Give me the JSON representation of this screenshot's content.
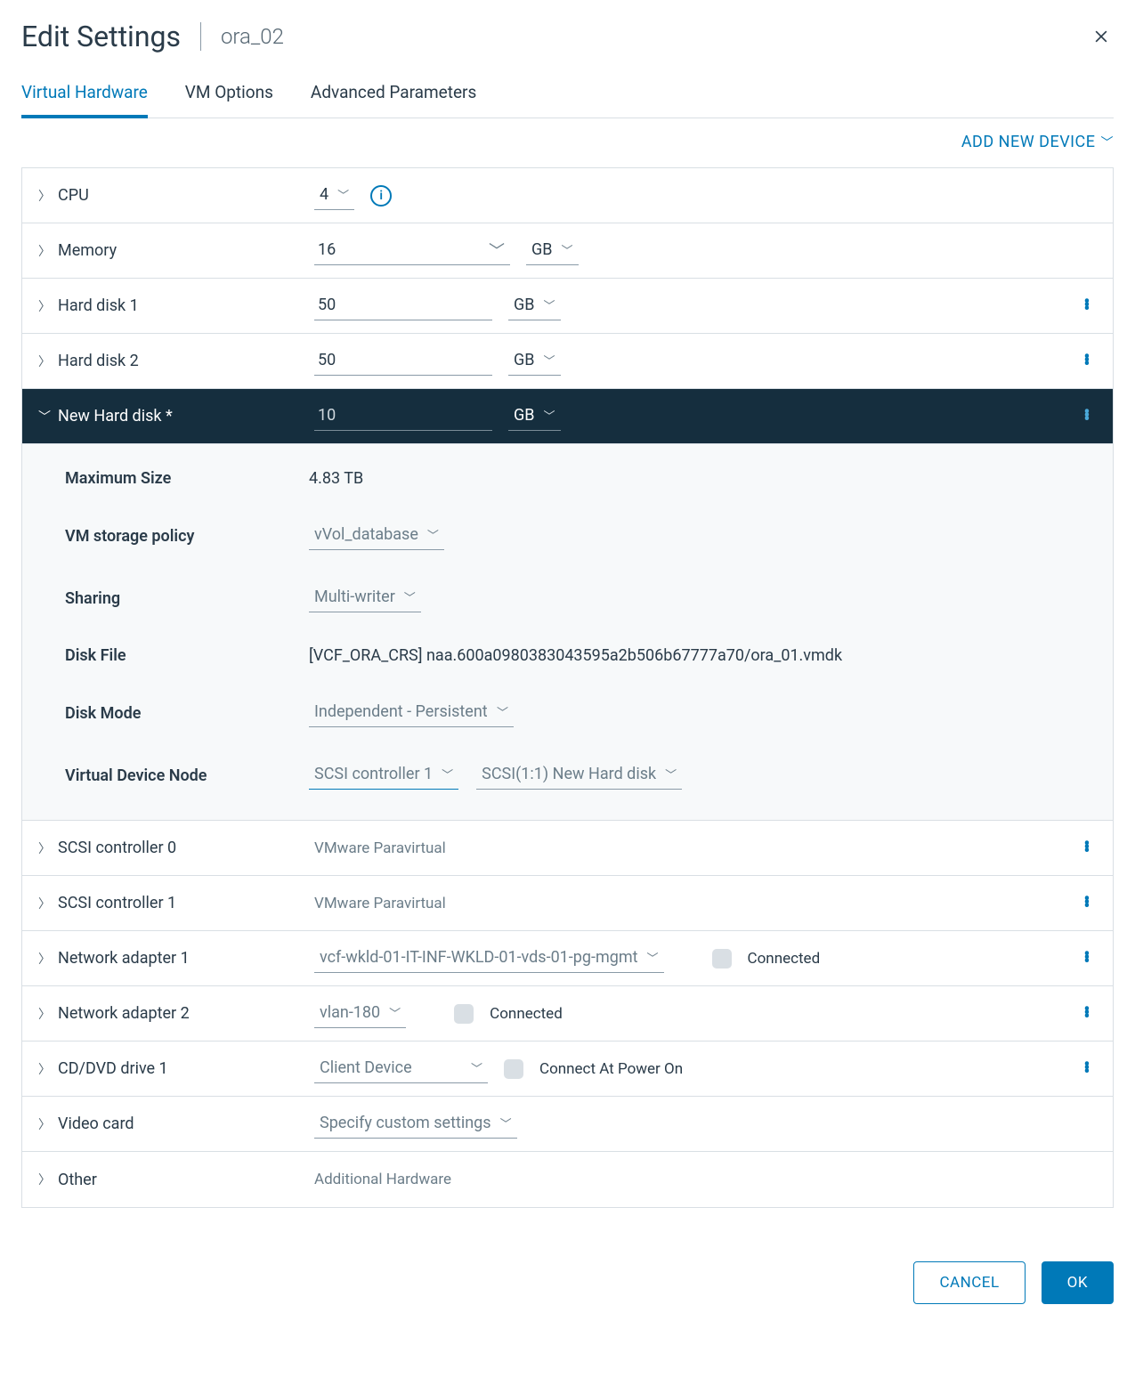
{
  "header": {
    "title": "Edit Settings",
    "vm_name": "ora_02"
  },
  "tabs": {
    "t0": "Virtual Hardware",
    "t1": "VM Options",
    "t2": "Advanced Parameters",
    "active": 0
  },
  "add_device": "ADD NEW DEVICE",
  "rows": {
    "cpu": {
      "label": "CPU",
      "value": "4"
    },
    "memory": {
      "label": "Memory",
      "value": "16",
      "unit": "GB"
    },
    "hd1": {
      "label": "Hard disk 1",
      "value": "50",
      "unit": "GB"
    },
    "hd2": {
      "label": "Hard disk 2",
      "value": "50",
      "unit": "GB"
    },
    "newhd": {
      "label": "New Hard disk *",
      "value": "10",
      "unit": "GB"
    },
    "scsi0": {
      "label": "SCSI controller 0",
      "value": "VMware Paravirtual"
    },
    "scsi1": {
      "label": "SCSI controller 1",
      "value": "VMware Paravirtual"
    },
    "net1": {
      "label": "Network adapter 1",
      "value": "vcf-wkld-01-IT-INF-WKLD-01-vds-01-pg-mgmt",
      "conn": "Connected"
    },
    "net2": {
      "label": "Network adapter 2",
      "value": "vlan-180",
      "conn": "Connected"
    },
    "cd": {
      "label": "CD/DVD drive 1",
      "value": "Client Device",
      "conn": "Connect At Power On"
    },
    "video": {
      "label": "Video card",
      "value": "Specify custom settings"
    },
    "other": {
      "label": "Other",
      "value": "Additional Hardware"
    }
  },
  "newhd_detail": {
    "max_size": {
      "label": "Maximum Size",
      "value": "4.83 TB"
    },
    "policy": {
      "label": "VM storage policy",
      "value": "vVol_database"
    },
    "sharing": {
      "label": "Sharing",
      "value": "Multi-writer"
    },
    "diskfile": {
      "label": "Disk File",
      "value": "[VCF_ORA_CRS] naa.600a0980383043595a2b506b67777a70/ora_01.vmdk"
    },
    "diskmode": {
      "label": "Disk Mode",
      "value": "Independent - Persistent"
    },
    "vdn": {
      "label": "Virtual Device Node",
      "ctrl": "SCSI controller 1",
      "slot": "SCSI(1:1) New Hard disk"
    }
  },
  "footer": {
    "cancel": "CANCEL",
    "ok": "OK"
  }
}
